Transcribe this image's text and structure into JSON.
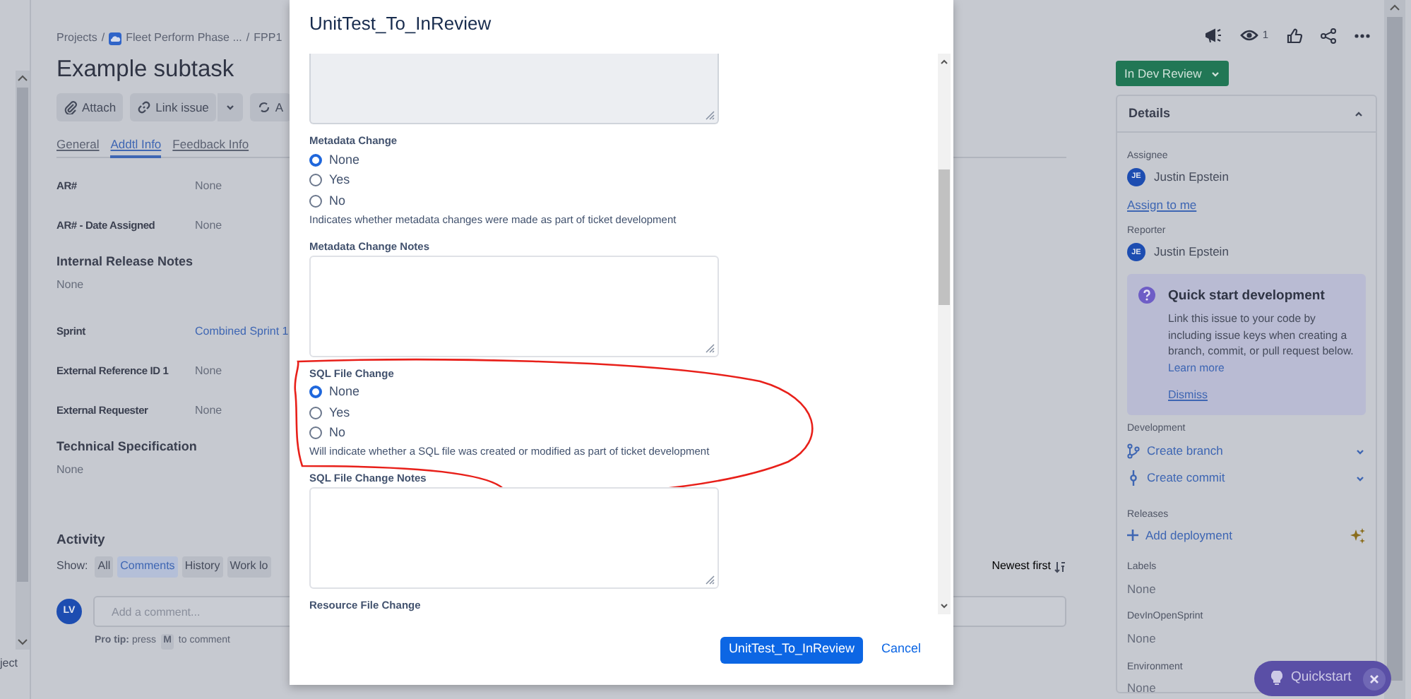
{
  "sidebar": {
    "footer_text": "ject"
  },
  "breadcrumbs": [
    {
      "kind": "plain",
      "label": "Projects"
    },
    {
      "kind": "separator",
      "label": "/"
    },
    {
      "kind": "project",
      "label": "Fleet Perform Phase ..."
    },
    {
      "kind": "separator",
      "label": "/"
    },
    {
      "kind": "plain",
      "label": "FPP1"
    }
  ],
  "issue": {
    "title": "Example subtask"
  },
  "toolbar": [
    {
      "kind": "attach",
      "label": "Attach"
    },
    {
      "kind": "link",
      "label": "Link issue"
    },
    {
      "kind": "caret"
    },
    {
      "kind": "cycle",
      "label": "A"
    }
  ],
  "tabs": [
    {
      "label": "General",
      "selected": false
    },
    {
      "label": "Addtl Info",
      "selected": true
    },
    {
      "label": "Feedback Info",
      "selected": false
    }
  ],
  "fields": [
    {
      "kind": "inline",
      "label": "AR#",
      "value": "None",
      "link": false
    },
    {
      "kind": "inline",
      "label": "AR# - Date Assigned",
      "value": "None",
      "link": false
    },
    {
      "kind": "block",
      "label": "Internal Release Notes",
      "value": "None"
    },
    {
      "kind": "inline",
      "label": "Sprint",
      "value": "Combined Sprint 1",
      "link": true
    },
    {
      "kind": "inline",
      "label": "External Reference ID 1",
      "value": "None",
      "link": false
    },
    {
      "kind": "inline",
      "label": "External Requester",
      "value": "None",
      "link": false
    },
    {
      "kind": "block",
      "label": "Technical Specification",
      "value": "None"
    }
  ],
  "activity": {
    "title": "Activity",
    "show_label": "Show:",
    "filters": [
      {
        "label": "All",
        "selected": false
      },
      {
        "label": "Comments",
        "selected": true
      },
      {
        "label": "History",
        "selected": false
      },
      {
        "label": "Work lo",
        "selected": false
      }
    ],
    "sort": "Newest first",
    "avatar": "LV",
    "comment_placeholder": "Add a comment...",
    "pro_tip": "**Pro tip:** press",
    "pro_tip_key": "M",
    "pro_tip_end": "to comment"
  },
  "header_actions": {
    "watchers": "1"
  },
  "status_button": "In Dev Review",
  "details": {
    "title": "Details",
    "expanded": true,
    "people": [
      {
        "label": "Assignee",
        "initials": "JE",
        "name": "Justin Epstein",
        "link": "Assign to me"
      },
      {
        "label": "Reporter",
        "initials": "JE",
        "name": "Justin Epstein"
      }
    ],
    "quick_start": {
      "title": "Quick start development",
      "text": "Link this issue to your code by including issue keys when creating a branch, commit, or pull request below.",
      "learn_more": "Learn more",
      "dismiss": "Dismiss"
    },
    "development": {
      "label": "Development",
      "actions": [
        {
          "kind": "branch",
          "label": "Create branch"
        },
        {
          "kind": "commit",
          "label": "Create commit"
        }
      ]
    },
    "releases": {
      "label": "Releases",
      "action": "Add deployment"
    },
    "fields": [
      {
        "label": "Labels",
        "value": "None"
      },
      {
        "label": "DevInOpenSprint",
        "value": "None"
      },
      {
        "label": "Environment",
        "value": "None"
      }
    ]
  },
  "quickstart_button": {
    "label": "Quickstart"
  },
  "modal": {
    "title": "UnitTest_To_InReview",
    "sections": [
      {
        "kind": "textarea",
        "hovered": true
      },
      {
        "kind": "radio",
        "label": "Metadata Change",
        "options": [
          {
            "label": "None",
            "selected": true
          },
          {
            "label": "Yes",
            "selected": false
          },
          {
            "label": "No",
            "selected": false
          }
        ],
        "help": "Indicates whether metadata changes were made as part of ticket development",
        "circled": false
      },
      {
        "kind": "textarea",
        "label": "Metadata Change Notes",
        "hovered": false
      },
      {
        "kind": "radio",
        "label": "SQL File Change",
        "options": [
          {
            "label": "None",
            "selected": true
          },
          {
            "label": "Yes",
            "selected": false
          },
          {
            "label": "No",
            "selected": false
          }
        ],
        "help": "Will indicate whether a SQL file was created or modified as part of ticket development",
        "circled": true
      },
      {
        "kind": "textarea",
        "label": "SQL File Change Notes",
        "hovered": false
      },
      {
        "kind": "heading",
        "label": "Resource File Change"
      }
    ],
    "submit": "UnitTest_To_InReview",
    "cancel": "Cancel"
  }
}
